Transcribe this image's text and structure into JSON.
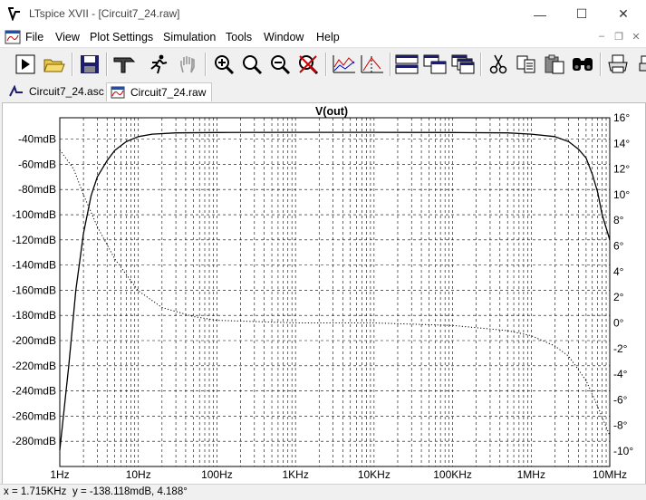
{
  "window": {
    "title": "LTspice XVII - [Circuit7_24.raw]",
    "minimize": "—",
    "maximize": "☐",
    "close": "✕"
  },
  "menu": {
    "items": [
      {
        "label": "File",
        "key": "F"
      },
      {
        "label": "View",
        "key": "V"
      },
      {
        "label": "Plot Settings",
        "key": "P"
      },
      {
        "label": "Simulation",
        "key": "S"
      },
      {
        "label": "Tools",
        "key": "T"
      },
      {
        "label": "Window",
        "key": "W"
      },
      {
        "label": "Help",
        "key": "H"
      }
    ],
    "mdi_minimize": "–",
    "mdi_restore": "❐",
    "mdi_close": "✕"
  },
  "toolbar": {
    "buttons": [
      "run-icon",
      "open-icon",
      "save-icon",
      "hammer-icon",
      "runner-icon",
      "hand-icon",
      "zoom-in-icon",
      "zoom-out-icon",
      "zoom-area-icon",
      "zoom-cancel-icon",
      "autorange-icon",
      "cursor-icon",
      "tile-horizontal-icon",
      "cascade-icon",
      "tile-vertical-icon",
      "cut-icon",
      "copy-icon",
      "paste-icon",
      "find-icon",
      "print-icon"
    ]
  },
  "tabs": [
    {
      "label": "Circuit7_24.asc",
      "active": false
    },
    {
      "label": "Circuit7_24.raw",
      "active": true
    }
  ],
  "chart_data": {
    "type": "line",
    "title": "V(out)",
    "x_scale": "log",
    "xlim": [
      1,
      10000000
    ],
    "x_ticks": [
      "1Hz",
      "10Hz",
      "100Hz",
      "1KHz",
      "10KHz",
      "100KHz",
      "1MHz",
      "10MHz"
    ],
    "y_left_ticks": [
      "-40mdB",
      "-60mdB",
      "-80mdB",
      "-100mdB",
      "-120mdB",
      "-140mdB",
      "-160mdB",
      "-180mdB",
      "-200mdB",
      "-220mdB",
      "-240mdB",
      "-260mdB",
      "-280mdB"
    ],
    "y_left_lim": [
      -300,
      -23
    ],
    "y_right_ticks": [
      "16°",
      "14°",
      "12°",
      "10°",
      "8°",
      "6°",
      "4°",
      "2°",
      "0°",
      "-2°",
      "-4°",
      "-6°",
      "-8°",
      "-10°"
    ],
    "y_right_lim": [
      -11.2,
      16
    ],
    "grid": true,
    "series": [
      {
        "style": "solid",
        "axis": "left",
        "x": [
          1,
          1.3,
          1.6,
          2,
          2.5,
          3,
          4,
          5,
          7,
          10,
          15,
          30,
          100,
          1000,
          10000,
          100000,
          500000,
          1000000,
          2000000,
          3000000,
          4000000,
          5000000,
          6000000,
          7000000,
          8000000,
          10000000
        ],
        "y": [
          -287,
          -220,
          -160,
          -115,
          -85,
          -70,
          -57,
          -49,
          -42,
          -38,
          -36,
          -35,
          -34.7,
          -34.6,
          -34.6,
          -34.7,
          -35,
          -36,
          -38,
          -42,
          -48,
          -55,
          -68,
          -82,
          -100,
          -120
        ]
      },
      {
        "style": "dotted",
        "axis": "right",
        "x": [
          1,
          1.5,
          2,
          3,
          5,
          10,
          20,
          50,
          100,
          1000,
          10000,
          100000,
          500000,
          1000000,
          2000000,
          3000000,
          5000000,
          7000000,
          10000000
        ],
        "y": [
          13.5,
          12.0,
          10.0,
          7.5,
          5.0,
          2.5,
          1.2,
          0.5,
          0.2,
          0.0,
          0.0,
          -0.2,
          -0.6,
          -1.0,
          -1.8,
          -2.6,
          -4.5,
          -6.5,
          -8.8
        ]
      }
    ]
  },
  "status": {
    "x": "x = 1.715KHz",
    "y": "y = -138.118mdB, 4.188°"
  }
}
